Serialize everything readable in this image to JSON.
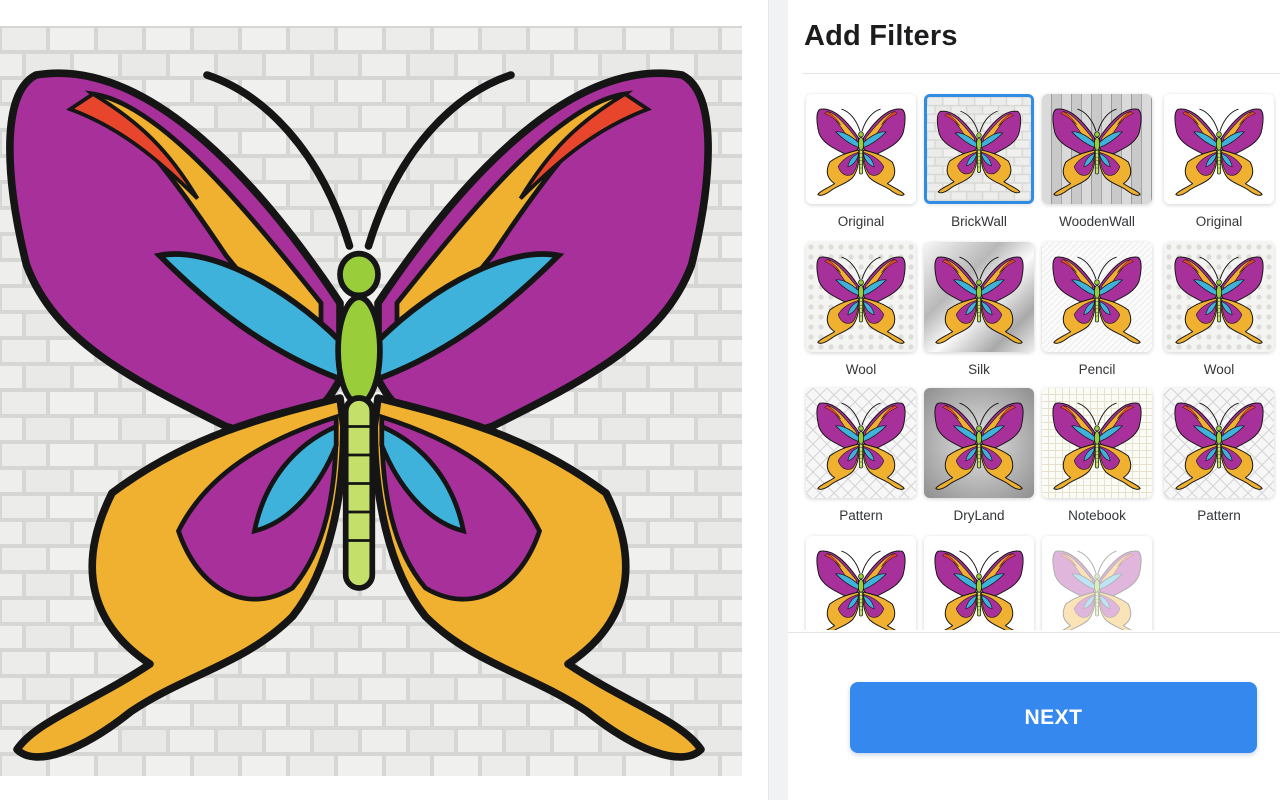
{
  "panel": {
    "title": "Add Filters",
    "next_label": "NEXT"
  },
  "preview": {
    "applied_filter": "BrickWall",
    "image": "butterfly"
  },
  "filters": [
    {
      "label": "Original",
      "background": "plain",
      "selected": false
    },
    {
      "label": "BrickWall",
      "background": "brick",
      "selected": true
    },
    {
      "label": "WoodenWall",
      "background": "wood",
      "selected": false
    },
    {
      "label": "Original",
      "background": "plain",
      "selected": false
    },
    {
      "label": "Wool",
      "background": "wool",
      "selected": false
    },
    {
      "label": "Silk",
      "background": "silk",
      "selected": false
    },
    {
      "label": "Pencil",
      "background": "pencil",
      "selected": false
    },
    {
      "label": "Wool",
      "background": "wool",
      "selected": false
    },
    {
      "label": "Pattern",
      "background": "pattern",
      "selected": false
    },
    {
      "label": "DryLand",
      "background": "dryland",
      "selected": false
    },
    {
      "label": "Notebook",
      "background": "notebook",
      "selected": false
    },
    {
      "label": "Pattern",
      "background": "pattern",
      "selected": false
    },
    {
      "label": "",
      "background": "plain",
      "selected": false
    },
    {
      "label": "",
      "background": "plain",
      "selected": false
    },
    {
      "label": "",
      "background": "plain",
      "selected": false
    }
  ],
  "colors": {
    "accent": "#3488ee",
    "selected_border": "#2f8de4",
    "wing_purple": "#a8309a",
    "wing_blue": "#3fb2dc",
    "wing_orange": "#f0b030",
    "wing_red": "#e8462c",
    "body_green": "#9acd3a"
  }
}
